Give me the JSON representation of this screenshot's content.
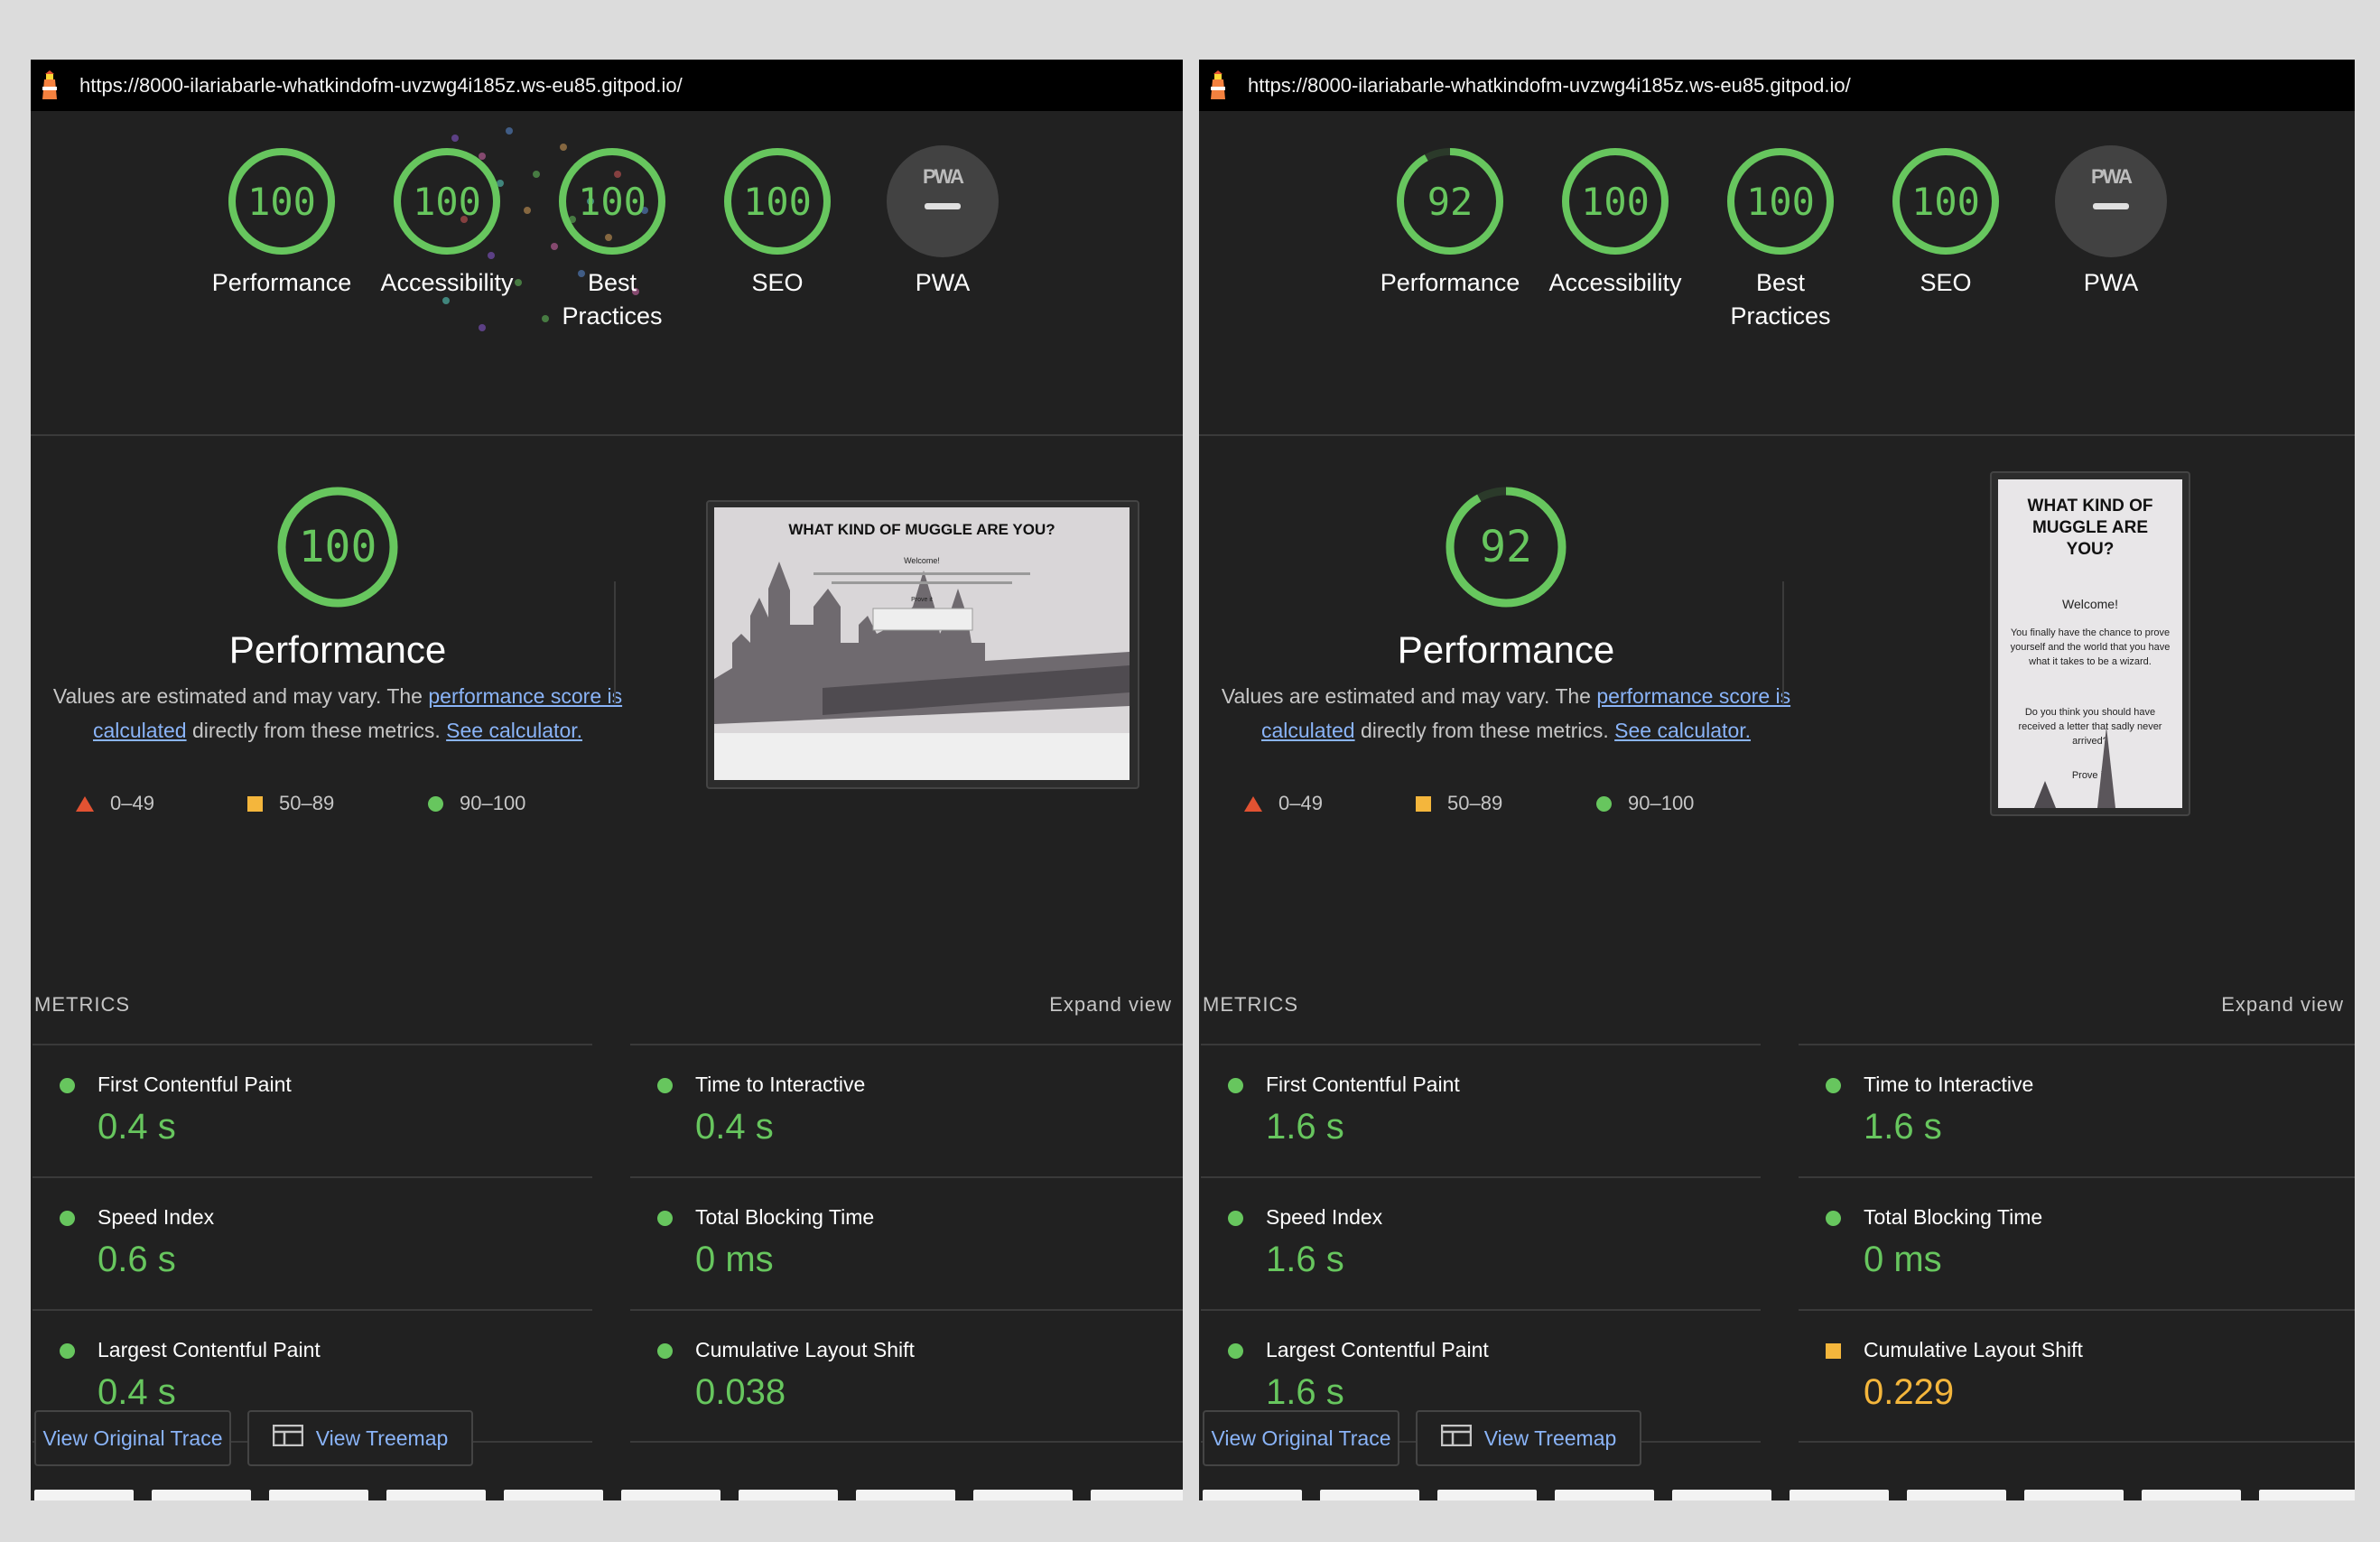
{
  "colors": {
    "pass": "#67c65e",
    "average": "#f4b63c",
    "fail": "#e25232",
    "panel_bg": "#212121",
    "link": "#8ab4f8"
  },
  "panels": [
    {
      "url": "https://8000-ilariabarle-whatkindofm-uvzwg4i185z.ws-eu85.gitpod.io/",
      "scores": [
        {
          "value": "100",
          "label": "Performance"
        },
        {
          "value": "100",
          "label": "Accessibility"
        },
        {
          "value": "100",
          "label": "Best Practices"
        },
        {
          "value": "100",
          "label": "SEO"
        }
      ],
      "pwa": {
        "badge": "PWA",
        "label": "PWA"
      },
      "main": {
        "score": "100",
        "title": "Performance",
        "desc_prefix": "Values are estimated and may vary. The ",
        "link_score": "performance score is calculated",
        "desc_middle": " directly from these metrics. ",
        "link_calc": "See calculator."
      },
      "legend": [
        "0–49",
        "50–89",
        "90–100"
      ],
      "screenshot": {
        "heading": "WHAT KIND OF MUGGLE ARE YOU?",
        "welcome": "Welcome!",
        "prove": "Prove it"
      },
      "metrics_title": "METRICS",
      "expand_label": "Expand view",
      "metrics": [
        {
          "name": "First Contentful Paint",
          "value": "0.4 s",
          "status": "pass"
        },
        {
          "name": "Time to Interactive",
          "value": "0.4 s",
          "status": "pass"
        },
        {
          "name": "Speed Index",
          "value": "0.6 s",
          "status": "pass"
        },
        {
          "name": "Total Blocking Time",
          "value": "0 ms",
          "status": "pass"
        },
        {
          "name": "Largest Contentful Paint",
          "value": "0.4 s",
          "status": "pass"
        },
        {
          "name": "Cumulative Layout Shift",
          "value": "0.038",
          "status": "pass"
        }
      ],
      "buttons": {
        "trace": "View Original Trace",
        "treemap": "View Treemap"
      }
    },
    {
      "url": "https://8000-ilariabarle-whatkindofm-uvzwg4i185z.ws-eu85.gitpod.io/",
      "scores": [
        {
          "value": "92",
          "label": "Performance"
        },
        {
          "value": "100",
          "label": "Accessibility"
        },
        {
          "value": "100",
          "label": "Best Practices"
        },
        {
          "value": "100",
          "label": "SEO"
        }
      ],
      "pwa": {
        "badge": "PWA",
        "label": "PWA"
      },
      "main": {
        "score": "92",
        "title": "Performance",
        "desc_prefix": "Values are estimated and may vary. The ",
        "link_score": "performance score is calculated",
        "desc_middle": " directly from these metrics. ",
        "link_calc": "See calculator."
      },
      "legend": [
        "0–49",
        "50–89",
        "90–100"
      ],
      "screenshot": {
        "heading": "WHAT KIND OF MUGGLE ARE YOU?",
        "welcome": "Welcome!",
        "text1": "You finally have the chance to prove yourself and the world that you have what it takes to be a wizard.",
        "text2": "Do you think you should have received a letter that sadly never arrived?",
        "prove": "Prove it!"
      },
      "metrics_title": "METRICS",
      "expand_label": "Expand view",
      "metrics": [
        {
          "name": "First Contentful Paint",
          "value": "1.6 s",
          "status": "pass"
        },
        {
          "name": "Time to Interactive",
          "value": "1.6 s",
          "status": "pass"
        },
        {
          "name": "Speed Index",
          "value": "1.6 s",
          "status": "pass"
        },
        {
          "name": "Total Blocking Time",
          "value": "0 ms",
          "status": "pass"
        },
        {
          "name": "Largest Contentful Paint",
          "value": "1.6 s",
          "status": "pass"
        },
        {
          "name": "Cumulative Layout Shift",
          "value": "0.229",
          "status": "average"
        }
      ],
      "buttons": {
        "trace": "View Original Trace",
        "treemap": "View Treemap"
      }
    }
  ]
}
